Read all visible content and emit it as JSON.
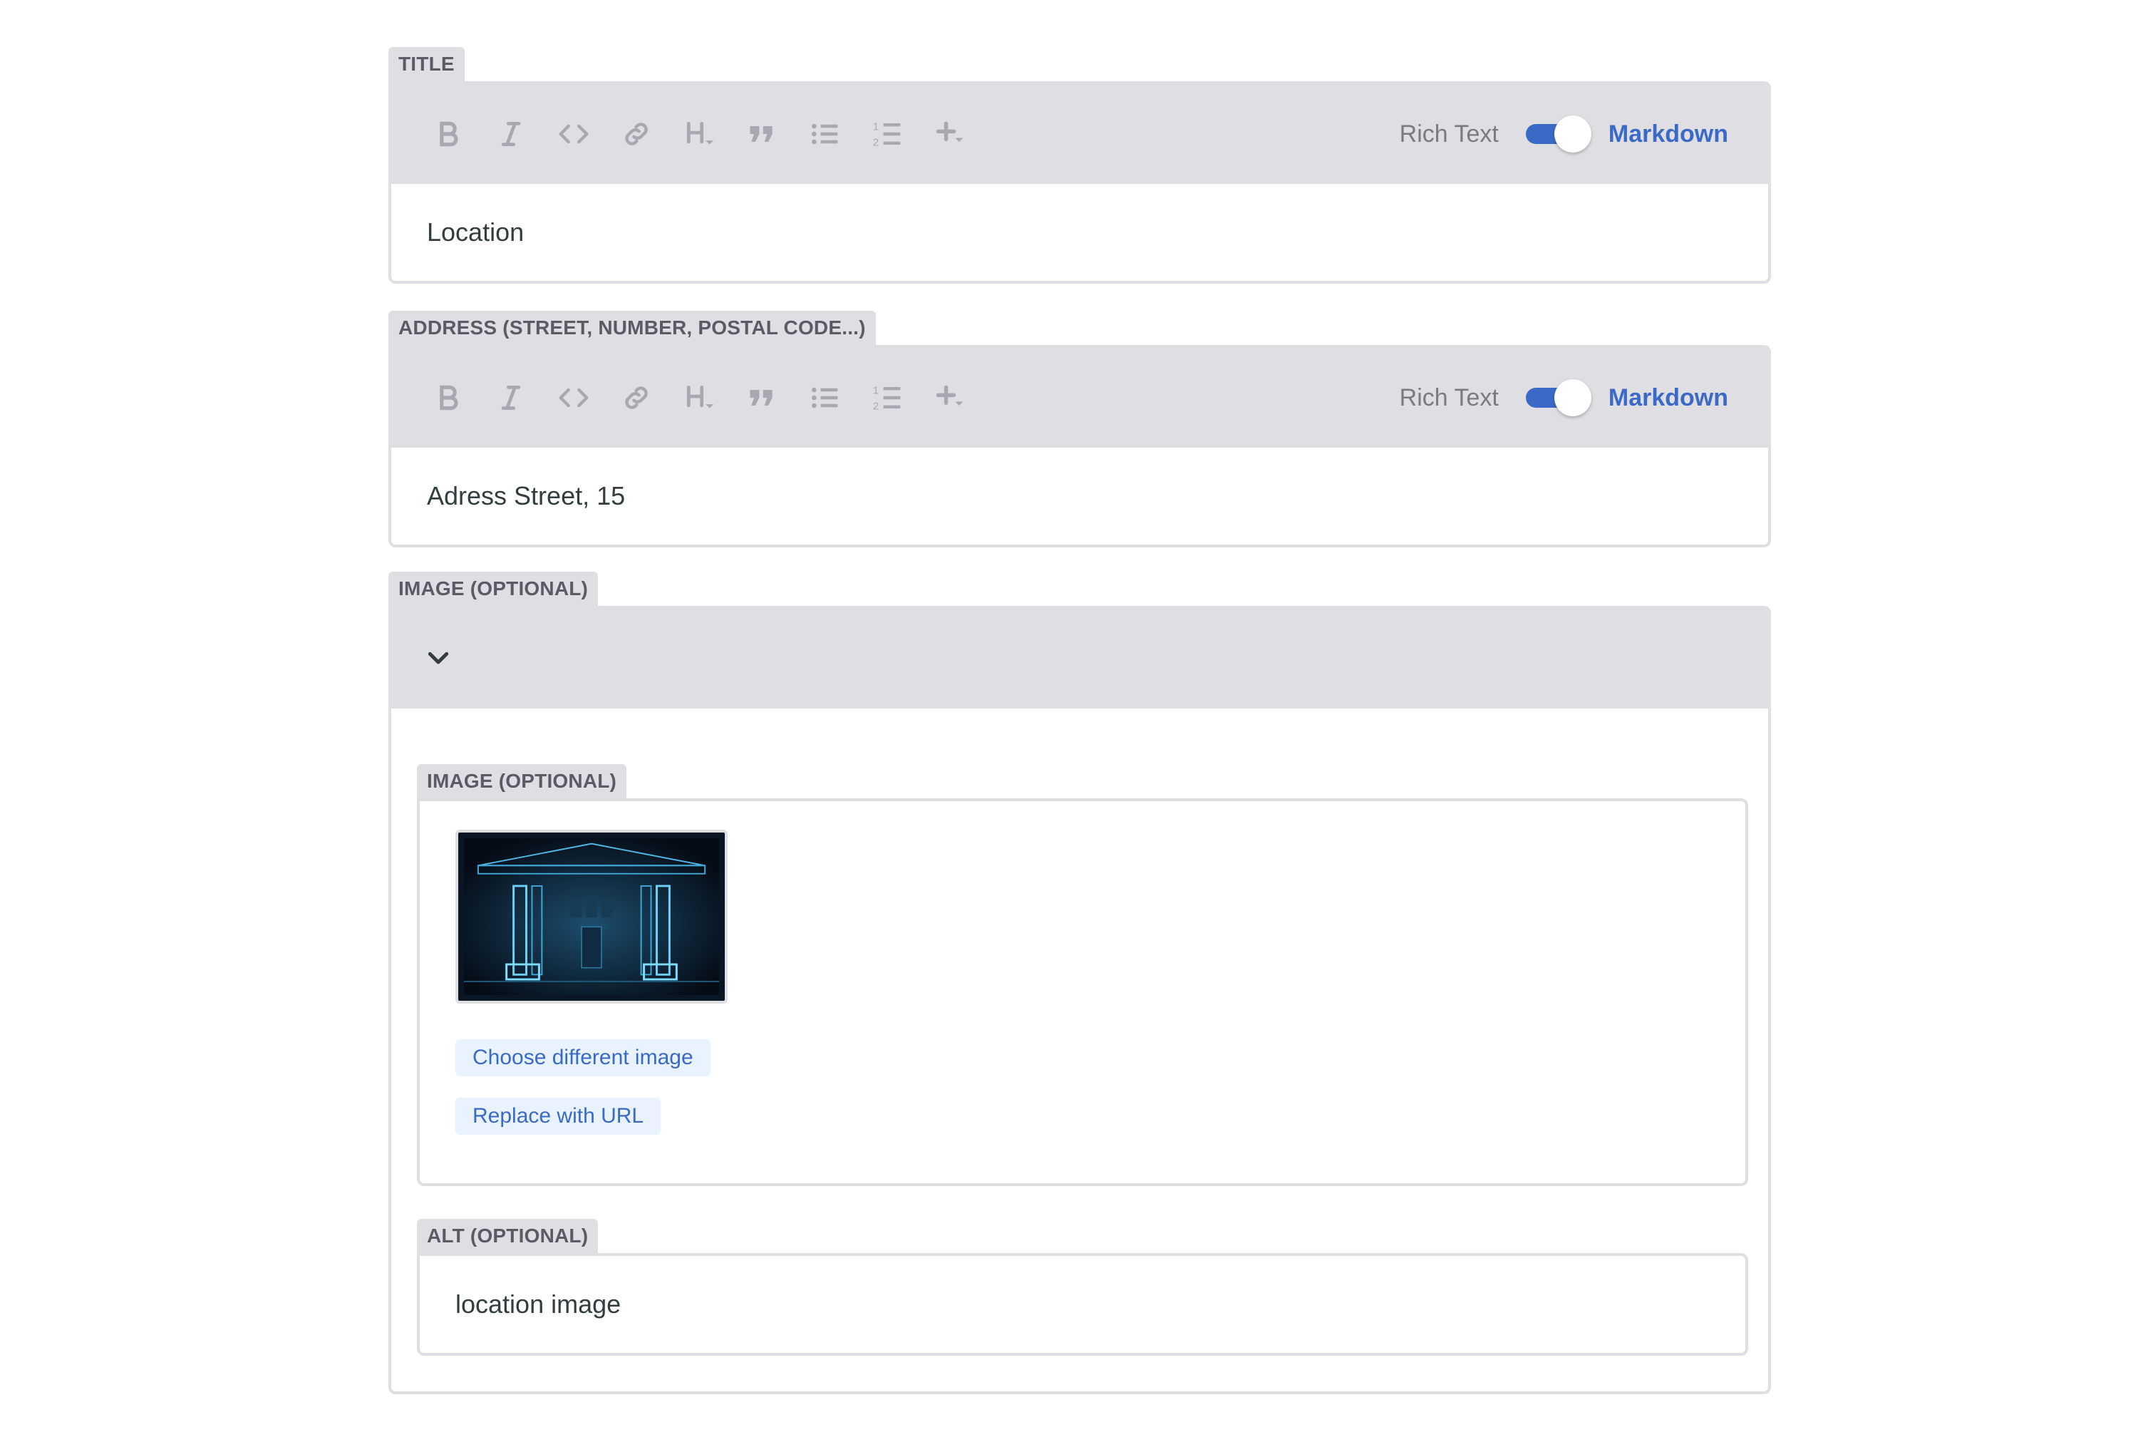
{
  "fields": {
    "title": {
      "label": "TITLE",
      "value": "Location",
      "mode_rich": "Rich Text",
      "mode_markdown": "Markdown"
    },
    "address": {
      "label": "ADDRESS (STREET, NUMBER, POSTAL CODE...)",
      "value": "Adress Street, 15",
      "mode_rich": "Rich Text",
      "mode_markdown": "Markdown"
    },
    "image_object": {
      "label": "IMAGE (OPTIONAL)",
      "image": {
        "label": "IMAGE (OPTIONAL)",
        "choose_button": "Choose different image",
        "replace_button": "Replace with URL"
      },
      "alt": {
        "label": "ALT (OPTIONAL)",
        "value": "location image"
      }
    }
  },
  "toolbar_icons": [
    "bold-icon",
    "italic-icon",
    "code-icon",
    "link-icon",
    "heading-icon",
    "quote-icon",
    "bulleted-list-icon",
    "numbered-list-icon",
    "add-component-icon"
  ],
  "colors": {
    "accent": "#3a69c7",
    "panel": "#dfdfe3",
    "text": "#313d3e",
    "button_bg": "#e8f3ff"
  }
}
